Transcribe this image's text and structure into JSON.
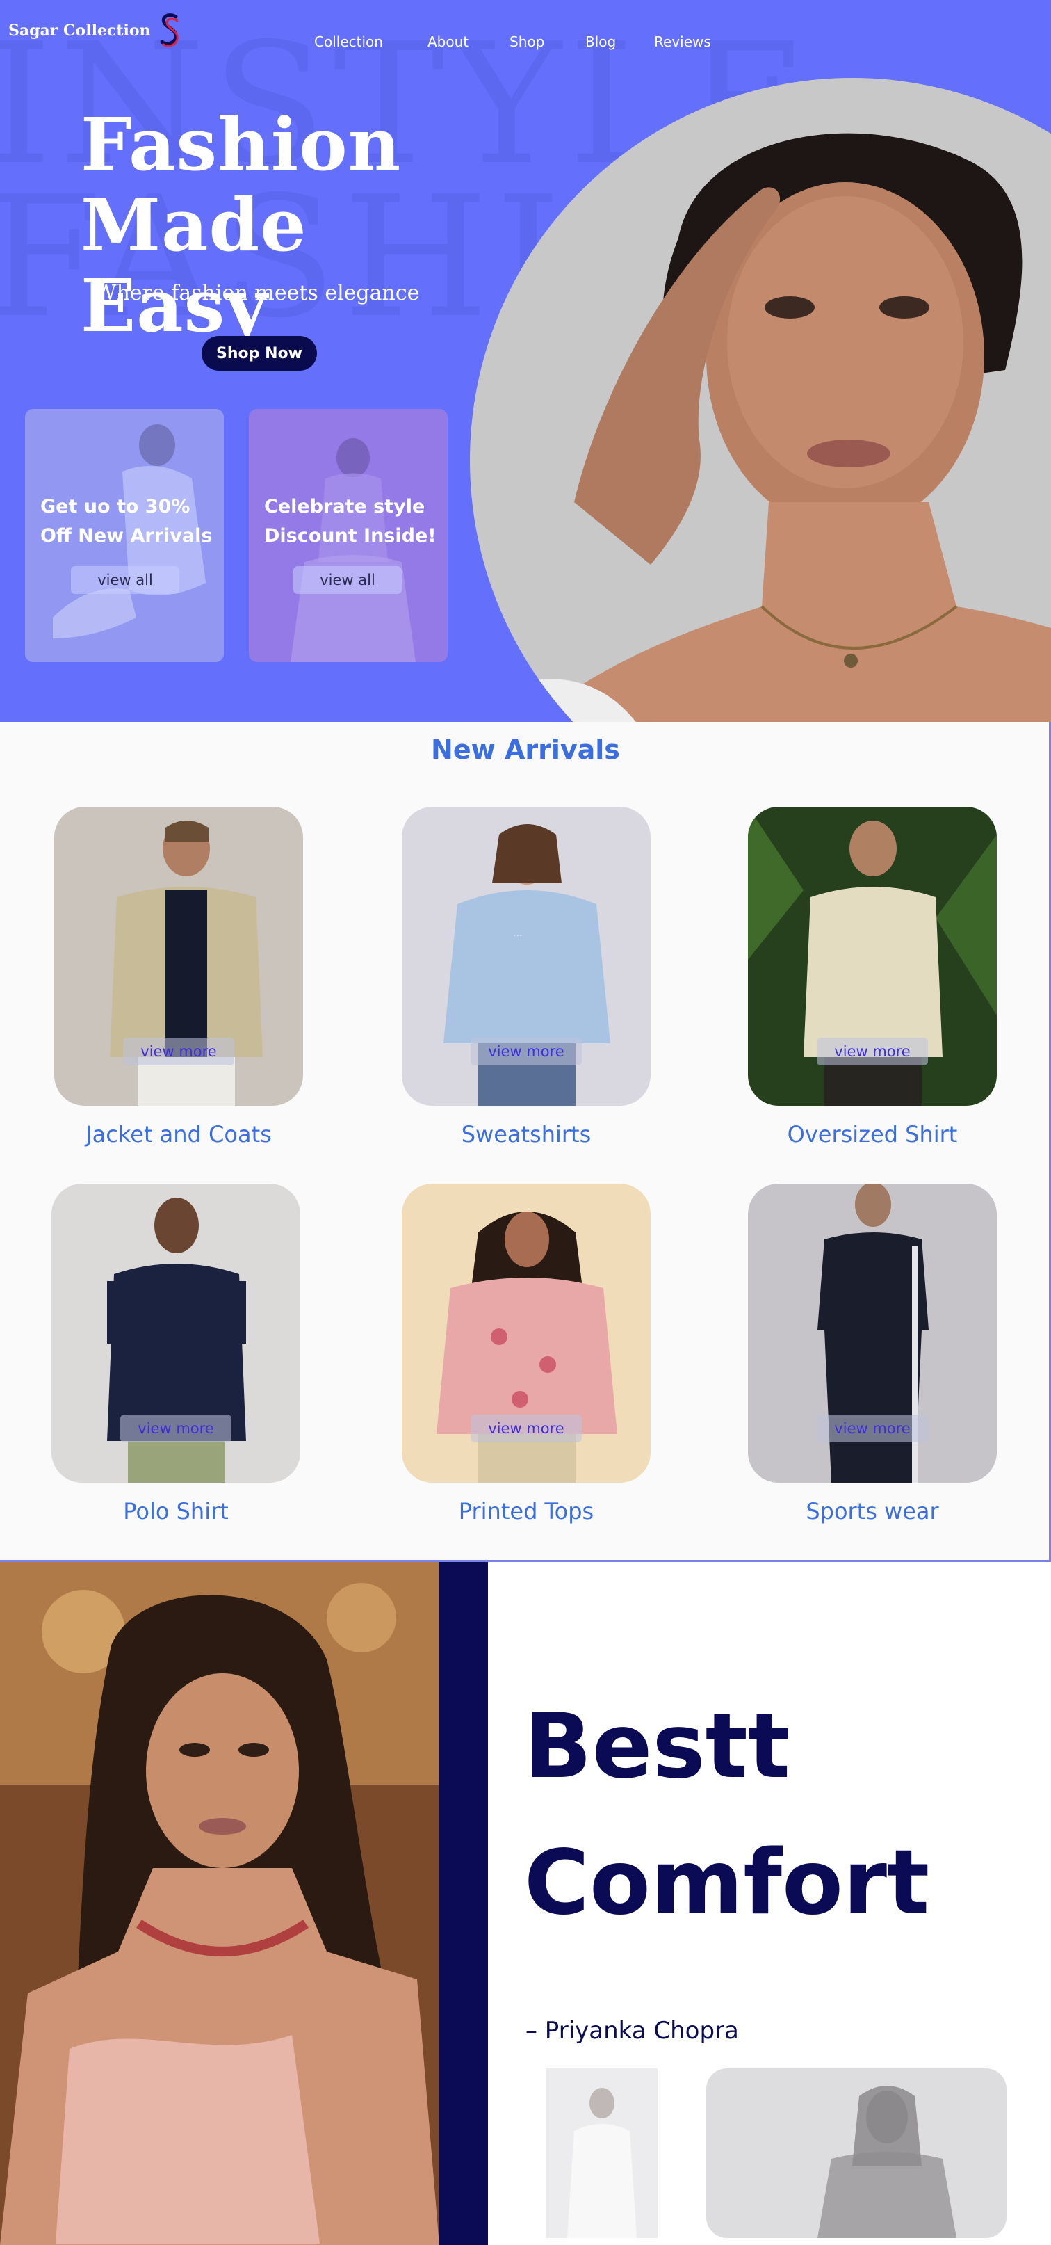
{
  "brand": {
    "name": "Sagar Collection",
    "logo_icon": "s-logo-icon"
  },
  "nav": {
    "items": [
      "Collection",
      "About",
      "Shop",
      "Blog",
      "Reviews"
    ]
  },
  "hero": {
    "title_line1": "Fashion",
    "title_line2": "Made Easy",
    "subtitle": "Where fashion meets elegance",
    "cta_label": "Shop Now",
    "promos": [
      {
        "text": "Get uo to 30% Off New Arrivals",
        "button": "view all"
      },
      {
        "text": "Celebrate style Discount Inside!",
        "button": "view all"
      }
    ]
  },
  "arrivals": {
    "title": "New Arrivals",
    "products": [
      {
        "name": "Jacket and Coats",
        "button": "view more"
      },
      {
        "name": "Sweatshirts",
        "button": "view more"
      },
      {
        "name": "Oversized Shirt",
        "button": "view more"
      },
      {
        "name": "Polo Shirt",
        "button": "view more"
      },
      {
        "name": "Printed Tops",
        "button": "view more"
      },
      {
        "name": "Sports wear",
        "button": "view more"
      }
    ]
  },
  "comfort": {
    "heading_line1": "Bestt",
    "heading_line2": "Comfort",
    "author": "– Priyanka Chopra"
  },
  "colors": {
    "hero_bg": "#6470fb",
    "navy": "#0a0b54",
    "accent_blue": "#3b6fe0",
    "view_more_text": "#3e2ee0"
  }
}
